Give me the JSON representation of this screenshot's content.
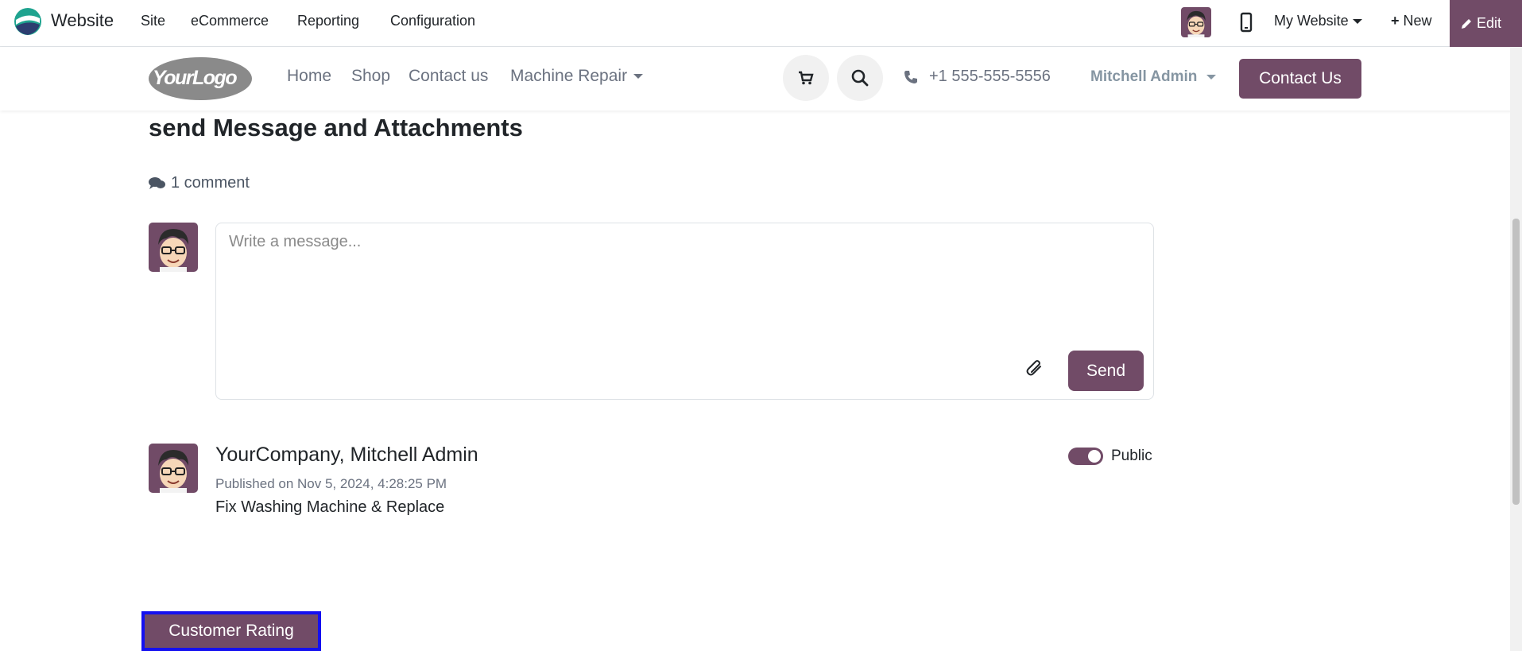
{
  "topbar": {
    "app_name": "Website",
    "menus": [
      "Site",
      "eCommerce",
      "Reporting",
      "Configuration"
    ],
    "my_website": "My Website",
    "new_label": "New",
    "edit_label": "Edit"
  },
  "site_header": {
    "logo_text": "YourLogo",
    "nav": [
      "Home",
      "Shop",
      "Contact us",
      "Machine Repair"
    ],
    "phone": "+1 555-555-5556",
    "user": "Mitchell Admin",
    "contact_button": "Contact Us"
  },
  "content": {
    "title": "send Message and Attachments",
    "comment_count": "1 comment",
    "composer_placeholder": "Write a message...",
    "send_label": "Send",
    "message": {
      "author": "YourCompany, Mitchell Admin",
      "date": "Published on Nov 5, 2024, 4:28:25 PM",
      "body": "Fix Washing Machine & Replace",
      "visibility": "Public"
    },
    "rating_button": "Customer Rating"
  },
  "colors": {
    "brand": "#714b67",
    "highlight": "#1410f0"
  }
}
